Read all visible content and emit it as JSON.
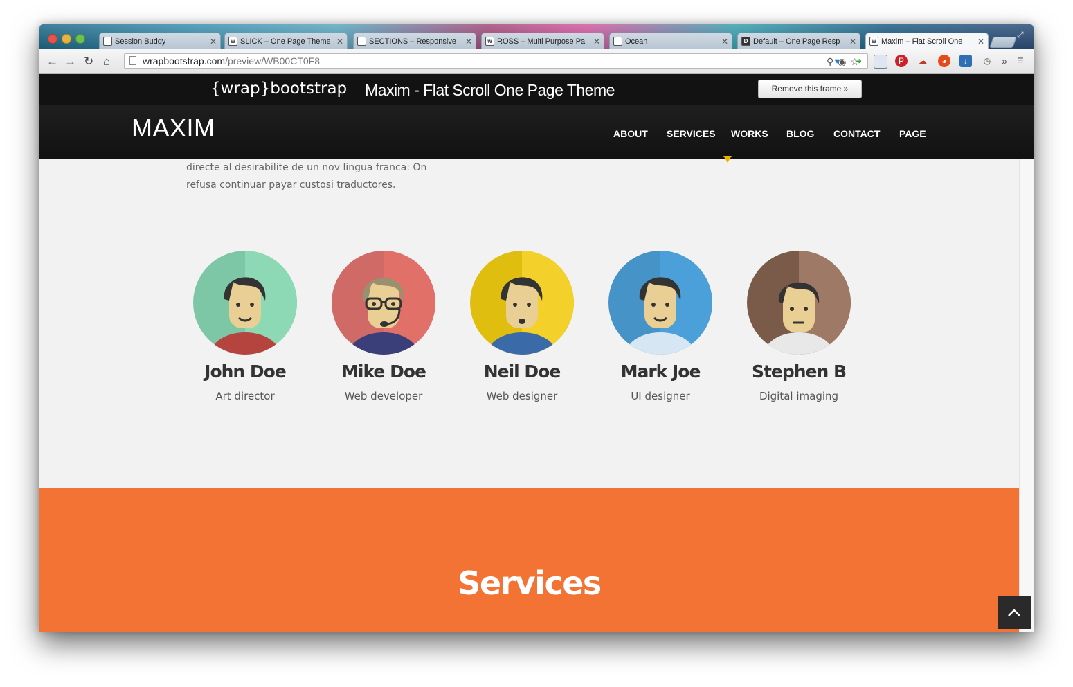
{
  "browser": {
    "tabs": [
      {
        "label": "Session Buddy",
        "favicon": "session-buddy-icon"
      },
      {
        "label": "SLICK – One Page Theme",
        "favicon": "w"
      },
      {
        "label": "SECTIONS – Responsive",
        "favicon": "page"
      },
      {
        "label": "ROSS – Multi Purpose Pa",
        "favicon": "w"
      },
      {
        "label": "Ocean",
        "favicon": "page"
      },
      {
        "label": "Default – One Page Resp",
        "favicon": "D."
      },
      {
        "label": "Maxim – Flat Scroll One",
        "favicon": "w"
      }
    ],
    "active_tab": 6,
    "url_host": "wrapbootstrap.com",
    "url_path": "/preview/WB00CT0F8"
  },
  "wrapbar": {
    "logo": "{wrap}bootstrap",
    "title": "Maxim - Flat Scroll One Page Theme",
    "remove_button": "Remove this frame »"
  },
  "site": {
    "brand": "MAXIM",
    "nav": [
      "ABOUT",
      "SERVICES",
      "WORKS",
      "BLOG",
      "CONTACT",
      "PAGE"
    ],
    "intro_text": "directe al desirabilite de un nov lingua franca: On refusa continuar payar custosi traductores.",
    "team": [
      {
        "name": "John Doe",
        "role": "Art director",
        "bg": "#8dd9b5",
        "bg_dark": "#7ec7a6",
        "shirt": "#b5443e"
      },
      {
        "name": "Mike Doe",
        "role": "Web developer",
        "bg": "#e07068",
        "bg_dark": "#cf6a67",
        "shirt": "#3a3f7a"
      },
      {
        "name": "Neil Doe",
        "role": "Web designer",
        "bg": "#f3d02a",
        "bg_dark": "#dfbe10",
        "shirt": "#3b6aa8"
      },
      {
        "name": "Mark Joe",
        "role": "UI designer",
        "bg": "#4ca0d9",
        "bg_dark": "#4693c8",
        "shirt": "#d6e6f2"
      },
      {
        "name": "Stephen B",
        "role": "Digital imaging",
        "bg": "#9e7a66",
        "bg_dark": "#7a5a48",
        "shirt": "#e8e8e8"
      }
    ],
    "services_title": "Services",
    "accent": "#f37335"
  }
}
